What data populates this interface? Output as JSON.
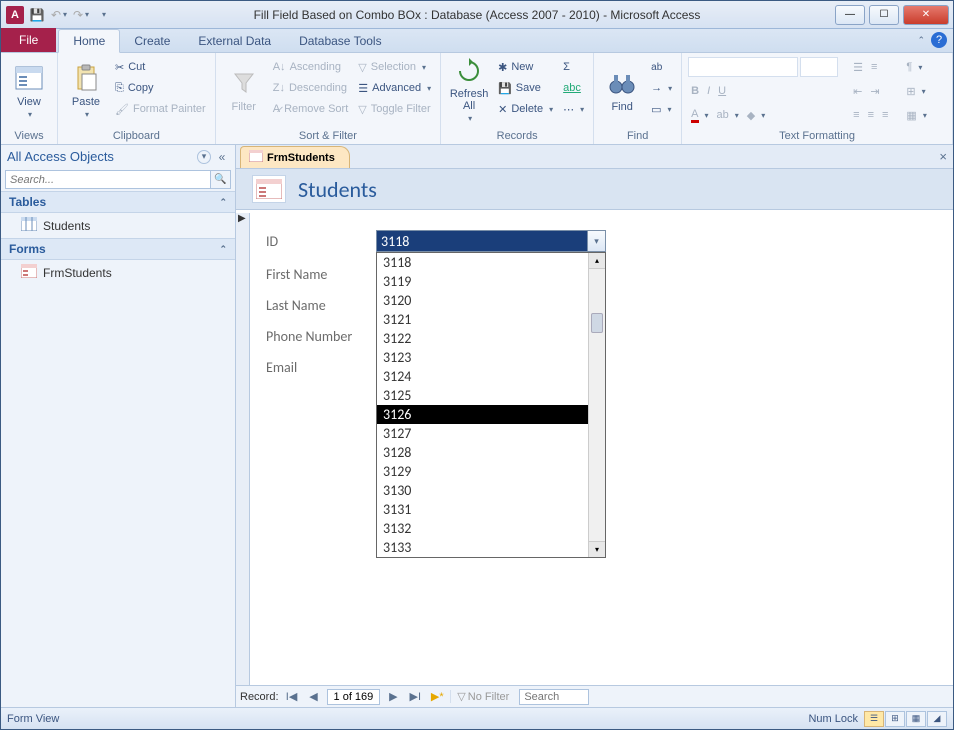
{
  "app_icon_letter": "A",
  "title": "Fill Field Based on Combo BOx : Database (Access 2007 - 2010)  -  Microsoft Access",
  "ribbon": {
    "file": "File",
    "tabs": [
      "Home",
      "Create",
      "External Data",
      "Database Tools"
    ],
    "active_tab": 0,
    "groups": {
      "views": {
        "label": "Views",
        "view": "View"
      },
      "clipboard": {
        "label": "Clipboard",
        "paste": "Paste",
        "cut": "Cut",
        "copy": "Copy",
        "format_painter": "Format Painter"
      },
      "sortfilter": {
        "label": "Sort & Filter",
        "filter": "Filter",
        "asc": "Ascending",
        "desc": "Descending",
        "remove": "Remove Sort",
        "selection": "Selection",
        "advanced": "Advanced",
        "toggle": "Toggle Filter"
      },
      "records": {
        "label": "Records",
        "refresh": "Refresh All",
        "new": "New",
        "save": "Save",
        "delete": "Delete",
        "totals": "Σ",
        "spelling_icon": "abc",
        "more_icon": "⋯"
      },
      "find": {
        "label": "Find",
        "find": "Find",
        "replace_icon": "ab",
        "goto_icon": "→",
        "select_icon": "▭"
      },
      "textformat": {
        "label": "Text Formatting"
      }
    }
  },
  "navpane": {
    "title": "All Access Objects",
    "search_placeholder": "Search...",
    "sections": [
      {
        "title": "Tables",
        "items": [
          "Students"
        ]
      },
      {
        "title": "Forms",
        "items": [
          "FrmStudents"
        ]
      }
    ]
  },
  "doc": {
    "tab_label": "FrmStudents",
    "form_title": "Students",
    "fields": {
      "id": "ID",
      "first_name": "First Name",
      "last_name": "Last Name",
      "phone": "Phone Number",
      "email": "Email"
    },
    "combo_value": "3118",
    "combo_items": [
      "3118",
      "3119",
      "3120",
      "3121",
      "3122",
      "3123",
      "3124",
      "3125",
      "3126",
      "3127",
      "3128",
      "3129",
      "3130",
      "3131",
      "3132",
      "3133"
    ],
    "combo_highlight_index": 8
  },
  "recnav": {
    "label": "Record:",
    "position": "1 of 169",
    "nofilter": "No Filter",
    "search_placeholder": "Search"
  },
  "statusbar": {
    "left": "Form View",
    "numlock": "Num Lock"
  }
}
